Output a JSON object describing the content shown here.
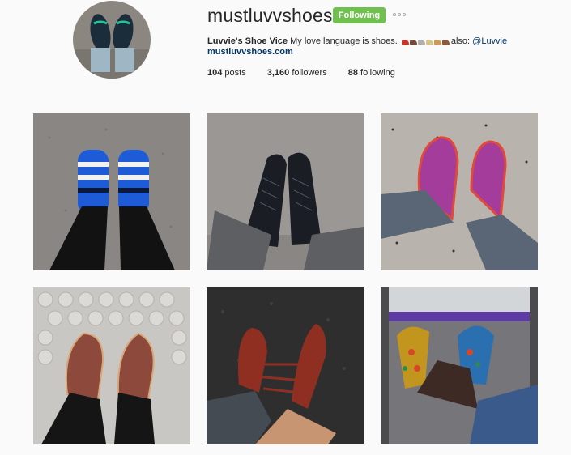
{
  "profile": {
    "username": "mustluvvshoes",
    "follow_label": "Following",
    "bio_name": "Luvvie's Shoe Vice",
    "bio_text": "My love language is shoes.",
    "bio_also": "also:",
    "bio_mention": "@Luvvie",
    "website": "mustluvvshoes.com"
  },
  "stats": {
    "posts_count": "104",
    "posts_label": "posts",
    "followers_count": "3,160",
    "followers_label": "followers",
    "following_count": "88",
    "following_label": "following"
  },
  "grid": {
    "posts": [
      "blue-striped-slip-ons",
      "black-woven-sneakers",
      "purple-suede-wingtips",
      "brown-leather-oxfords",
      "red-strappy-heels",
      "patterned-pumps"
    ]
  },
  "colors": {
    "follow_green": "#70c050",
    "link_blue": "#003569",
    "background": "#fafafa"
  }
}
